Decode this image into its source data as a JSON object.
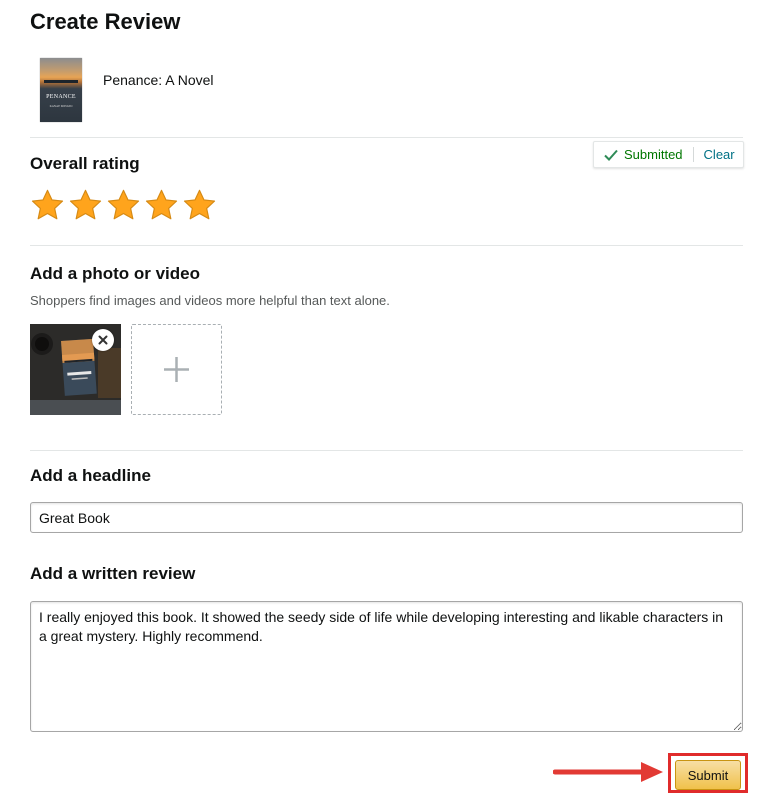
{
  "page": {
    "title": "Create Review"
  },
  "product": {
    "name": "Penance: A Novel",
    "cover_title": "PENANCE",
    "cover_author": "KANAE MINATO"
  },
  "rating": {
    "heading": "Overall rating",
    "value": 5,
    "max": 5,
    "star_color": "#ffa41c",
    "status_text": "Submitted",
    "clear_label": "Clear"
  },
  "media": {
    "heading": "Add a photo or video",
    "subtext": "Shoppers find images and videos more helpful than text alone.",
    "remove_icon": "close-icon",
    "add_icon": "plus-icon"
  },
  "headline": {
    "heading": "Add a headline",
    "value": "Great Book"
  },
  "review": {
    "heading": "Add a written review",
    "value": "I really enjoyed this book. It showed the seedy side of life while developing interesting and likable characters in a great mystery. Highly recommend."
  },
  "submit": {
    "label": "Submit",
    "button_color": "#f0c14b",
    "highlight_color": "#e02b2b"
  }
}
